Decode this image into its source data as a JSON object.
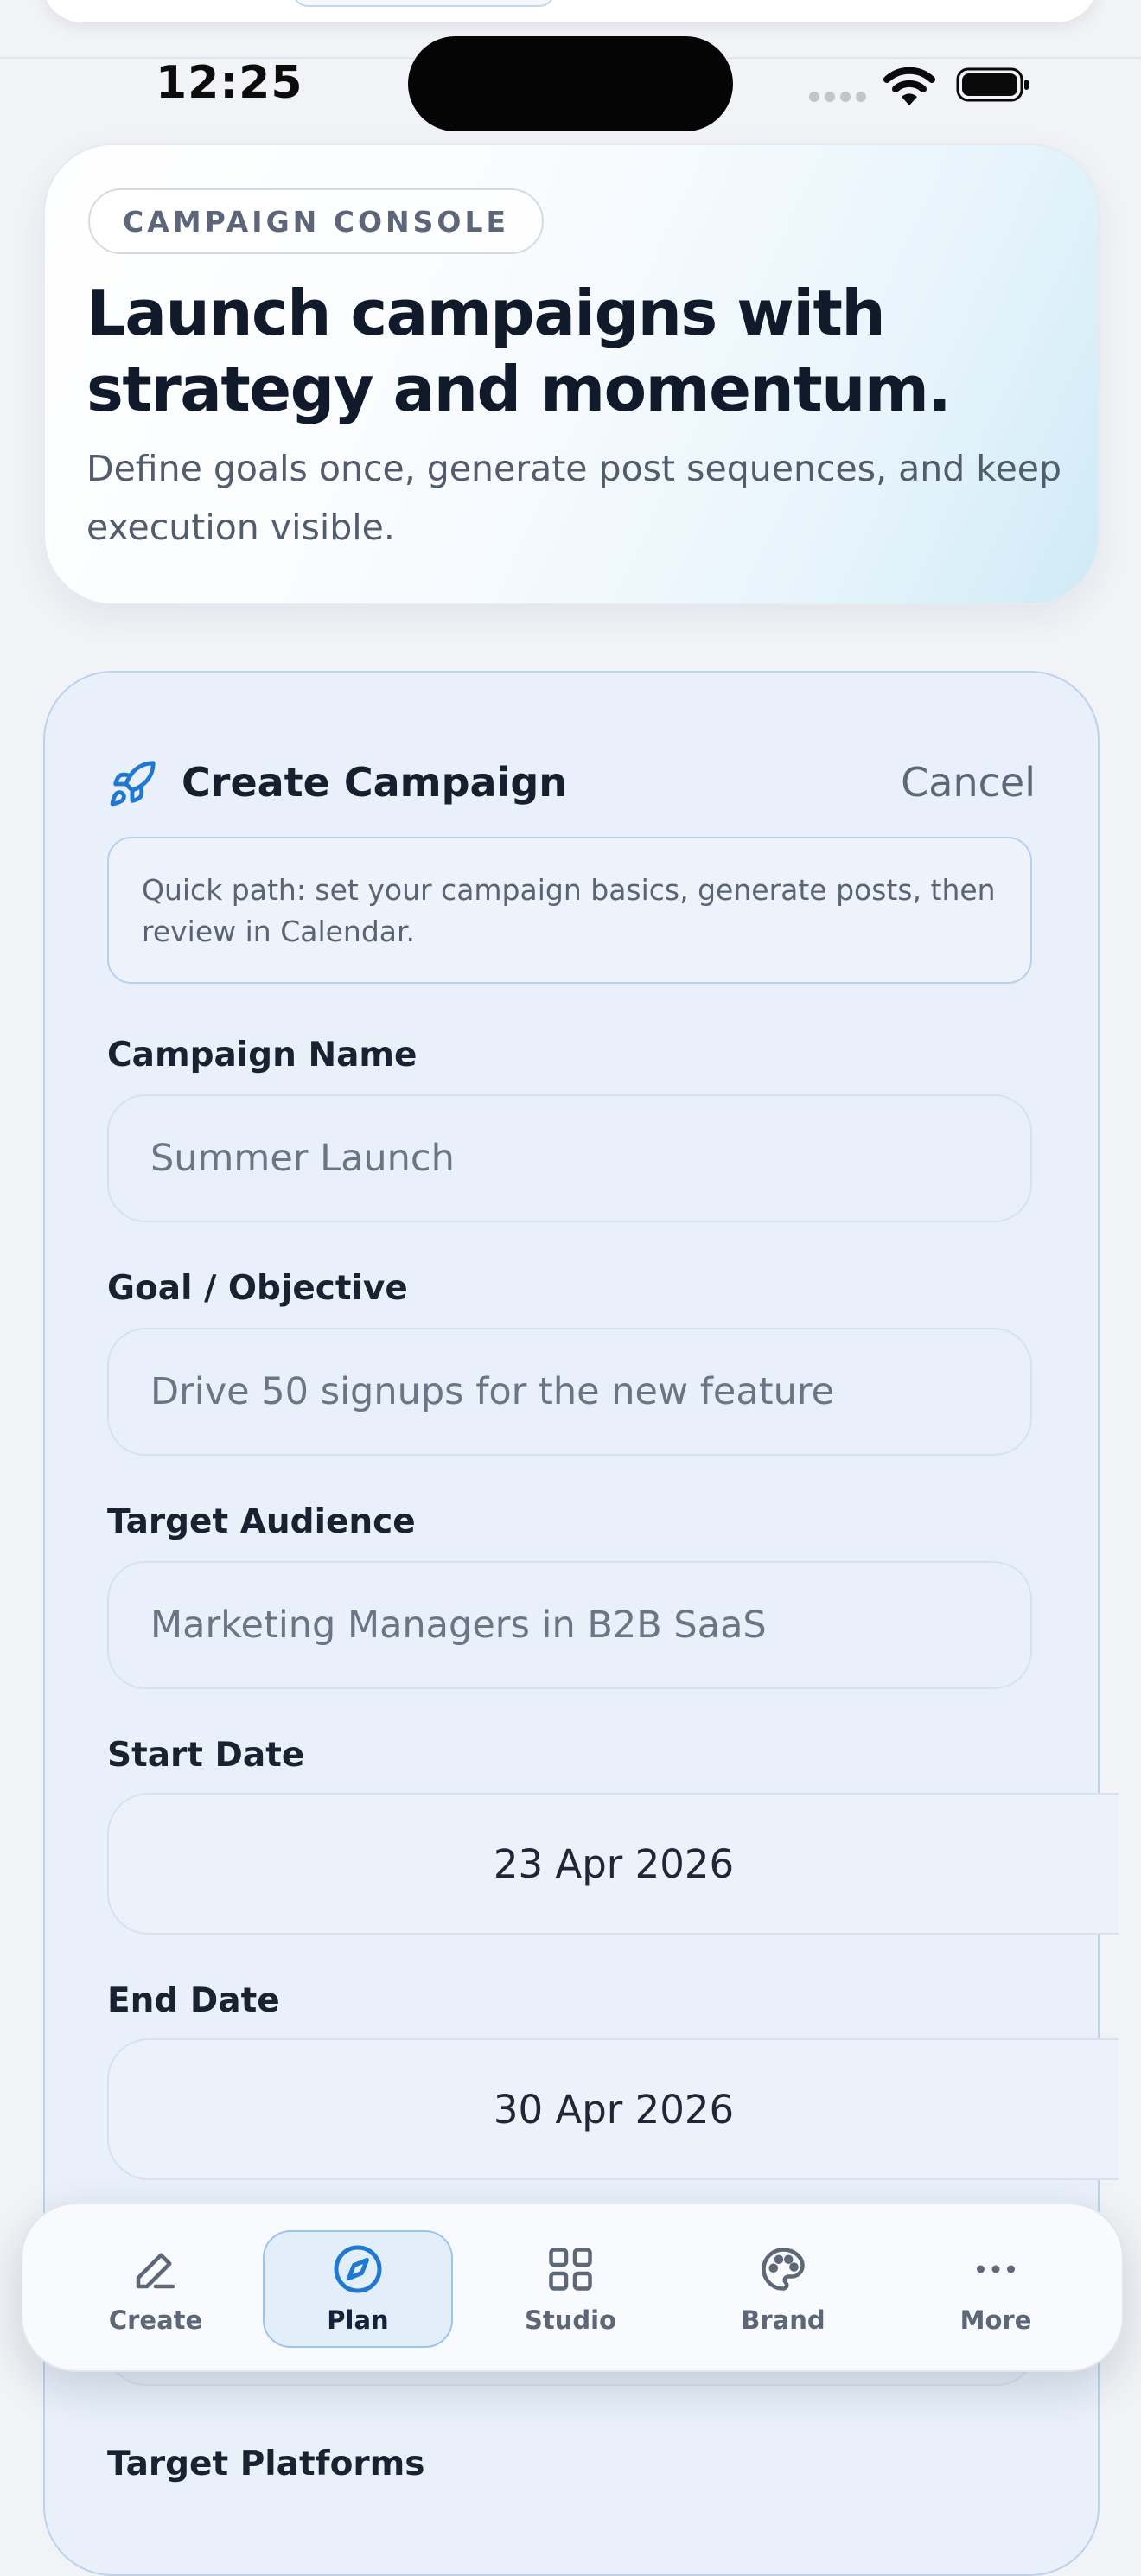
{
  "status_bar": {
    "time": "12:25"
  },
  "hero": {
    "eyebrow": "CAMPAIGN CONSOLE",
    "title_line1": "Launch campaigns with",
    "title_line2": "strategy and momentum.",
    "subtitle": "Define goals once, generate post sequences, and keep execution visible."
  },
  "form": {
    "title": "Create Campaign",
    "cancel_label": "Cancel",
    "hint": "Quick path: set your campaign basics, generate posts, then review in Calendar.",
    "campaign_name": {
      "label": "Campaign Name",
      "placeholder": "Summer Launch"
    },
    "goal": {
      "label": "Goal / Objective",
      "placeholder": "Drive 50 signups for the new feature"
    },
    "audience": {
      "label": "Target Audience",
      "placeholder": "Marketing Managers in B2B SaaS"
    },
    "start_date": {
      "label": "Start Date",
      "value": "23 Apr 2026"
    },
    "end_date": {
      "label": "End Date",
      "value": "30 Apr 2026"
    },
    "platforms": {
      "label": "Target Platforms"
    }
  },
  "tabs": [
    {
      "label": "Create",
      "icon": "pencil-icon",
      "active": false
    },
    {
      "label": "Plan",
      "icon": "compass-icon",
      "active": true
    },
    {
      "label": "Studio",
      "icon": "grid-icon",
      "active": false
    },
    {
      "label": "Brand",
      "icon": "palette-icon",
      "active": false
    },
    {
      "label": "More",
      "icon": "more-icon",
      "active": false
    }
  ],
  "colors": {
    "accent": "#1f78d1",
    "tab_active_bg": "#e3eefb",
    "card_bg": "#e9f0f9"
  }
}
